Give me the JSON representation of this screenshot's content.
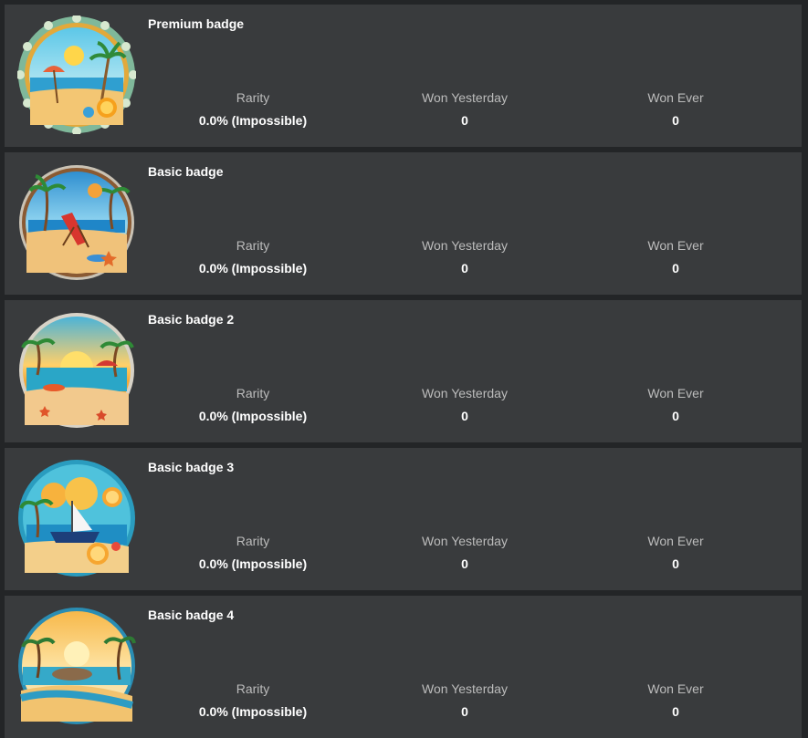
{
  "stats_labels": {
    "rarity": "Rarity",
    "won_yesterday": "Won Yesterday",
    "won_ever": "Won Ever"
  },
  "badges": [
    {
      "title": "Premium badge",
      "rarity": "0.0% (Impossible)",
      "won_yesterday": "0",
      "won_ever": "0",
      "frame": "scalloped",
      "art": "beach-umbrella"
    },
    {
      "title": "Basic badge",
      "rarity": "0.0% (Impossible)",
      "won_yesterday": "0",
      "won_ever": "0",
      "frame": "round",
      "art": "beach-chair"
    },
    {
      "title": "Basic badge 2",
      "rarity": "0.0% (Impossible)",
      "won_yesterday": "0",
      "won_ever": "0",
      "frame": "round",
      "art": "sunset-lagoon"
    },
    {
      "title": "Basic badge 3",
      "rarity": "0.0% (Impossible)",
      "won_yesterday": "0",
      "won_ever": "0",
      "frame": "round",
      "art": "sailboat-oranges"
    },
    {
      "title": "Basic badge 4",
      "rarity": "0.0% (Impossible)",
      "won_yesterday": "0",
      "won_ever": "0",
      "frame": "round",
      "art": "island-sunset"
    }
  ],
  "colors": {
    "card_bg": "#393b3d",
    "page_bg": "#232527",
    "title": "#ffffff",
    "label": "#bcbcbc"
  }
}
